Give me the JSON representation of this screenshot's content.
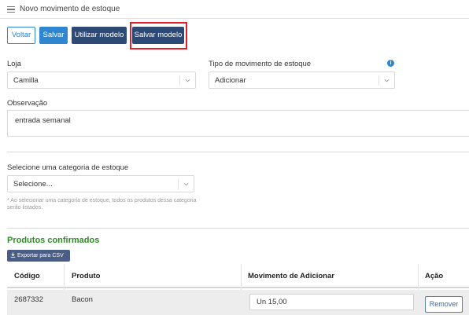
{
  "header": {
    "title": "Novo movimento de estoque",
    "menu_icon": "hamburger-menu-icon"
  },
  "toolbar": {
    "back_label": "Voltar",
    "save_label": "Salvar",
    "use_template_label": "Utilizar modelo",
    "save_template_label": "Salvar modelo"
  },
  "form": {
    "store_label": "Loja",
    "store_value": "Camilla",
    "movement_type_label": "Tipo de movimento de estoque",
    "movement_type_value": "Adicionar",
    "notes_label": "Observação",
    "notes_value": "entrada semanal",
    "category_label": "Selecione uma categoria de estoque",
    "category_value": "Selecione...",
    "category_hint": "* Ao selecionar uma categoria de estoque, todos os produtos dessa categoria serão listados."
  },
  "products": {
    "section_title": "Produtos confirmados",
    "export_label": "Exportar para CSV",
    "columns": [
      "Código",
      "Produto",
      "Movimento de Adicionar",
      "Ação"
    ],
    "rows": [
      {
        "code": "2687332",
        "product": "Bacon",
        "movement": "Un 15,00",
        "action": "Remover"
      }
    ]
  },
  "colors": {
    "primary": "#2e86d1",
    "dark_button": "#2c4a75",
    "highlight": "#e0202a",
    "section_title": "#2e8b25"
  }
}
